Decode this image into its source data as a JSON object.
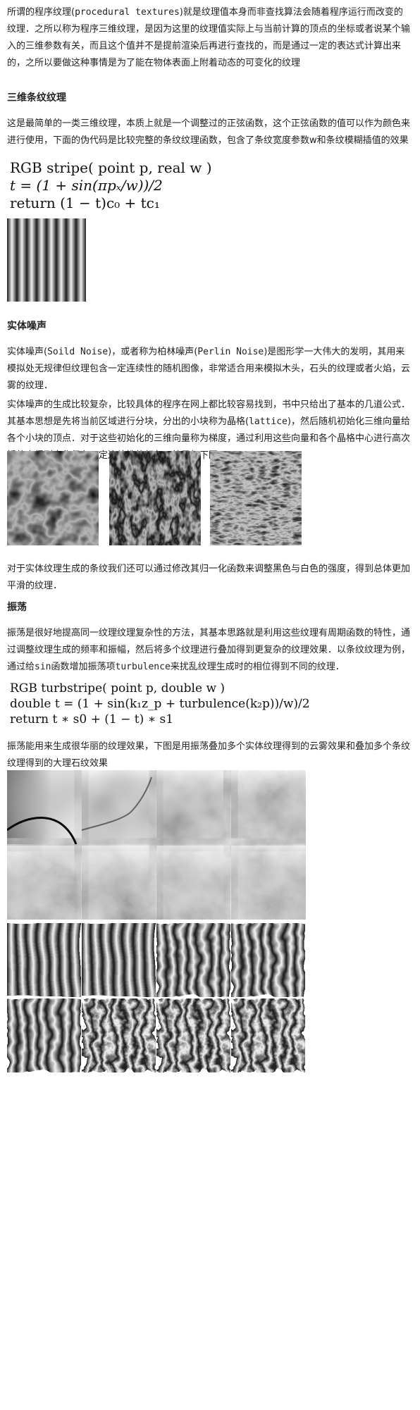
{
  "intro": {
    "before_code": "所谓的程序纹理(",
    "code": "procedural textures",
    "after_code": ")就是纹理值本身而非查找算法会随着程序运行而改变的纹理．之所以称为程序三维纹理，是因为这里的纹理值实际上与当前计算的顶点的坐标或者说某个输入的三维参数有关，而且这个值并不是提前渲染后再进行查找的，而是通过一定的表达式计算出来的，之所以要做这种事情是为了能在物体表面上附着动态的可变化的纹理"
  },
  "section_stripe": {
    "heading": "三维条纹纹理",
    "body": "这是最简单的一类三维纹理，本质上就是一个调整过的正弦函数，这个正弦函数的值可以作为颜色来进行使用，下面的伪代码是比较完整的条纹纹理函数，包含了条纹宽度参数w和条纹模糊插值的效果",
    "code_lines": [
      "RGB stripe( point p, real w )",
      "t = (1 + sin(πpₓ/w))/2",
      "return (1 − t)c₀ + tc₁"
    ]
  },
  "section_noise": {
    "heading": "实体噪声",
    "p1": {
      "a": "实体噪声(",
      "code1": "Soild Noise",
      "b": ")，或者称为柏林噪声(",
      "code2": "Perlin Noise",
      "c": ")是图形学一大伟大的发明，其用来模拟处无规律但纹理包含一定连续性的随机图像，非常适合用来模拟木头，石头的纹理或者火焰，云雾的纹理．"
    },
    "p2": {
      "a": "实体噪声的生成比较复杂，比较具体的程序在网上都比较容易找到，书中只给出了基本的几道公式．其基本思想是先将当前区域进行分块，分出的小块称为晶格(",
      "code": "lattice",
      "b": ")，然后随机初始化三维向量给各个小块的顶点．对于这些初始化的三维向量称为梯度，通过利用这些向量和各个晶格中心进行高次插值来得到变化但有一定连续性的颜色．效果如下图．"
    },
    "p3": "对于实体纹理生成的条纹我们还可以通过修改其归一化函数来调整黑色与白色的强度，得到总体更加平滑的纹理．"
  },
  "section_turb": {
    "heading": "振荡",
    "p1": {
      "a": "振荡是很好地提高同一纹理纹理复杂性的方法，其基本思路就是利用这些纹理有周期函数的特性，通过调整纹理生成的频率和振幅，然后将多个纹理进行叠加得到更复杂的纹理效果．以条纹纹理为例，通过给",
      "code1": "sin",
      "b": "函数增加振荡项",
      "code2": "turbulence",
      "c": "来扰乱纹理生成时的相位得到不同的纹理．"
    },
    "code_lines": [
      "RGB turbstripe( point p, double w )",
      "double t = (1 + sin(k₁z_p + turbulence(k₂p))/w)/2",
      "return t ∗ s0 + (1 − t) ∗ s1"
    ],
    "p2": "振荡能用来生成很华丽的纹理效果，下图是用振荡叠加多个实体纹理得到的云雾效果和叠加多个条纹纹理得到的大理石纹效果"
  }
}
